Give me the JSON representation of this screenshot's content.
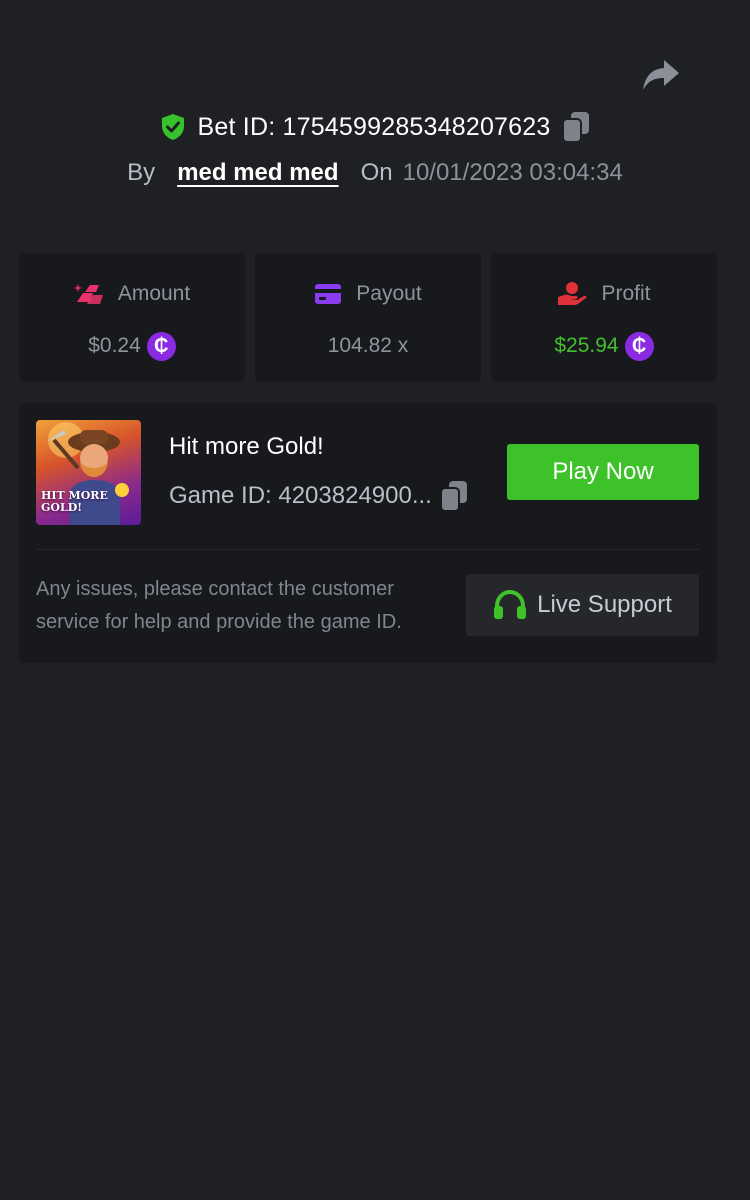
{
  "header": {
    "bet_id_label": "Bet ID: 1754599285348207623",
    "by_label": "By",
    "username": "med med med",
    "on_label": "On",
    "date": "10/01/2023 03:04:34"
  },
  "stats": {
    "amount": {
      "label": "Amount",
      "value": "$0.24"
    },
    "payout": {
      "label": "Payout",
      "value": "104.82 x"
    },
    "profit": {
      "label": "Profit",
      "value": "$25.94"
    },
    "coin_symbol": "₵"
  },
  "game": {
    "title": "Hit more Gold!",
    "game_id": "Game ID: 4203824900...",
    "thumbnail_text": [
      "HIT MORE",
      "GOLD!"
    ],
    "play_label": "Play Now"
  },
  "support": {
    "help_text": "Any issues, please contact the customer service for help and provide the game ID.",
    "button_label": "Live Support"
  },
  "colors": {
    "background": "#1f2024",
    "card": "#18191c",
    "accent_green": "#3dc22a",
    "coin_purple": "#8a2be2",
    "amount_icon": "#e8336a",
    "payout_icon": "#8a3cf0",
    "profit_icon": "#e0323a"
  },
  "icons": {
    "share": "share-icon",
    "verified": "shield-check-icon",
    "copy": "copy-icon",
    "amount": "gold-bars-icon",
    "payout": "credit-card-icon",
    "profit": "hand-money-icon",
    "headset": "headset-icon"
  }
}
